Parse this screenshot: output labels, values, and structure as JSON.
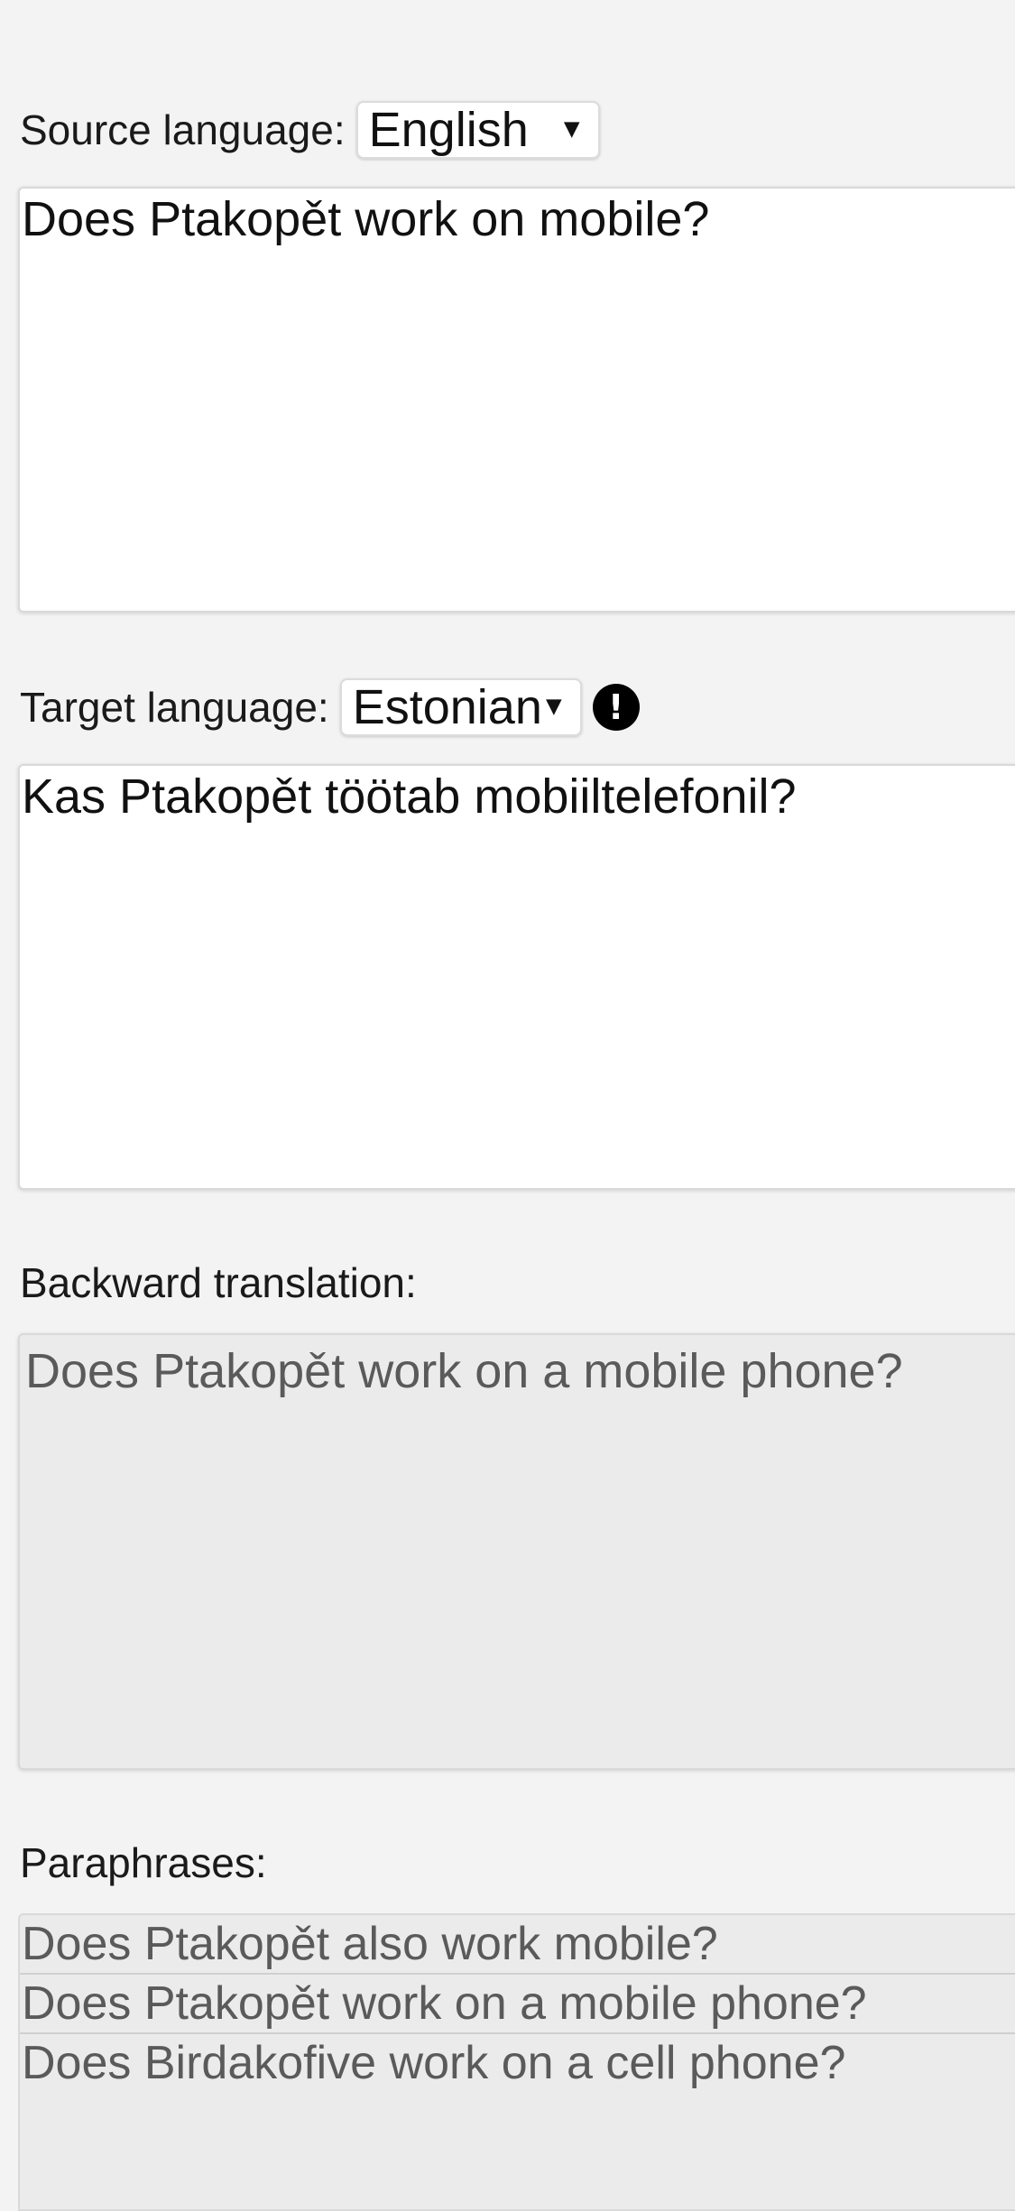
{
  "source": {
    "label": "Source language:",
    "language": "English",
    "text": "Does Ptakopět work on mobile?"
  },
  "target": {
    "label": "Target language:",
    "language": "Estonian",
    "warning_icon": "exclamation-circle",
    "text": "Kas Ptakopět töötab mobiiltelefonil?"
  },
  "backward": {
    "label": "Backward translation:",
    "text": "Does Ptakopět work on a mobile phone?"
  },
  "paraphrases": {
    "label": "Paraphrases:",
    "items": [
      "Does Ptakopět also work mobile?",
      "Does Ptakopět work on a mobile phone?",
      "Does Birdakofive work on a cell phone?"
    ]
  },
  "colors": {
    "background": "#f3f3f3",
    "readonly_bg": "#ebebeb",
    "editable_bg": "#ffffff"
  }
}
